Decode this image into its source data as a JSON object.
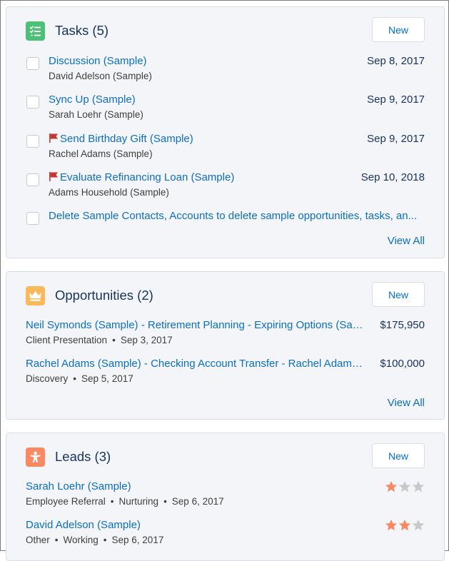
{
  "tasks": {
    "title": "Tasks (5)",
    "new_label": "New",
    "view_all": "View All",
    "icon": "task-checklist-icon",
    "items": [
      {
        "subject": "Discussion (Sample)",
        "who": "David Adelson (Sample)",
        "date": "Sep 8, 2017",
        "flag": false
      },
      {
        "subject": "Sync Up (Sample)",
        "who": "Sarah Loehr (Sample)",
        "date": "Sep 9, 2017",
        "flag": false
      },
      {
        "subject": "Send Birthday Gift (Sample)",
        "who": "Rachel Adams (Sample)",
        "date": "Sep 9, 2017",
        "flag": true
      },
      {
        "subject": "Evaluate Refinancing Loan (Sample)",
        "who": "Adams Household (Sample)",
        "date": "Sep 10, 2018",
        "flag": true
      },
      {
        "subject": "Delete Sample Contacts, Accounts to delete sample opportunities, tasks, an...",
        "who": "",
        "date": "",
        "flag": false
      }
    ]
  },
  "opportunities": {
    "title": "Opportunities (2)",
    "new_label": "New",
    "view_all": "View All",
    "icon": "crown-icon",
    "items": [
      {
        "name": "Neil Symonds (Sample) - Retirement Planning - Expiring Options (Sam...",
        "stage": "Client Presentation",
        "date": "Sep 3, 2017",
        "amount": "$175,950"
      },
      {
        "name": "Rachel Adams (Sample) - Checking Account Transfer - Rachel Adams (...",
        "stage": "Discovery",
        "date": "Sep 5, 2017",
        "amount": "$100,000"
      }
    ]
  },
  "leads": {
    "title": "Leads (3)",
    "new_label": "New",
    "icon": "lead-person-icon",
    "items": [
      {
        "name": "Sarah Loehr (Sample)",
        "source": "Employee Referral",
        "status": "Nurturing",
        "date": "Sep 6, 2017",
        "rating": 1
      },
      {
        "name": "David Adelson (Sample)",
        "source": "Other",
        "status": "Working",
        "date": "Sep 6, 2017",
        "rating": 2
      }
    ]
  },
  "separator": "•",
  "colors": {
    "tasks_icon": "#4bc076",
    "opportunities_icon": "#fcb95b",
    "leads_icon": "#f88962",
    "link": "#0b6ec4",
    "flag": "#c23934",
    "star_on": "#f88962",
    "star_off": "#c9c9c9"
  }
}
